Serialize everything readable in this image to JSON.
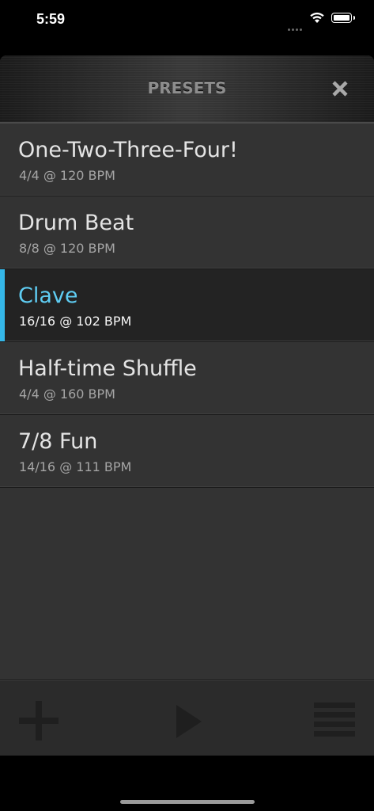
{
  "status_bar": {
    "time": "5:59",
    "icons": [
      "signal-dots-icon",
      "wifi-icon",
      "battery-icon"
    ]
  },
  "header": {
    "title": "PRESETS",
    "close_icon": "close-icon"
  },
  "presets": [
    {
      "name": "One-Two-Three-Four!",
      "meta": "4/4 @ 120 BPM",
      "selected": false
    },
    {
      "name": "Drum Beat",
      "meta": "8/8 @ 120 BPM",
      "selected": false
    },
    {
      "name": "Clave",
      "meta": "16/16 @ 102 BPM",
      "selected": true
    },
    {
      "name": "Half-time Shuffle",
      "meta": "4/4 @ 160 BPM",
      "selected": false
    },
    {
      "name": "7/8 Fun",
      "meta": "14/16 @ 111 BPM",
      "selected": false
    }
  ],
  "toolbar": {
    "icons": [
      "plus-icon",
      "play-icon",
      "menu-icon"
    ]
  },
  "colors": {
    "accent": "#35b7e8",
    "selected_title": "#5fcdf3",
    "panel_background": "#333333",
    "selected_background": "#232323"
  }
}
